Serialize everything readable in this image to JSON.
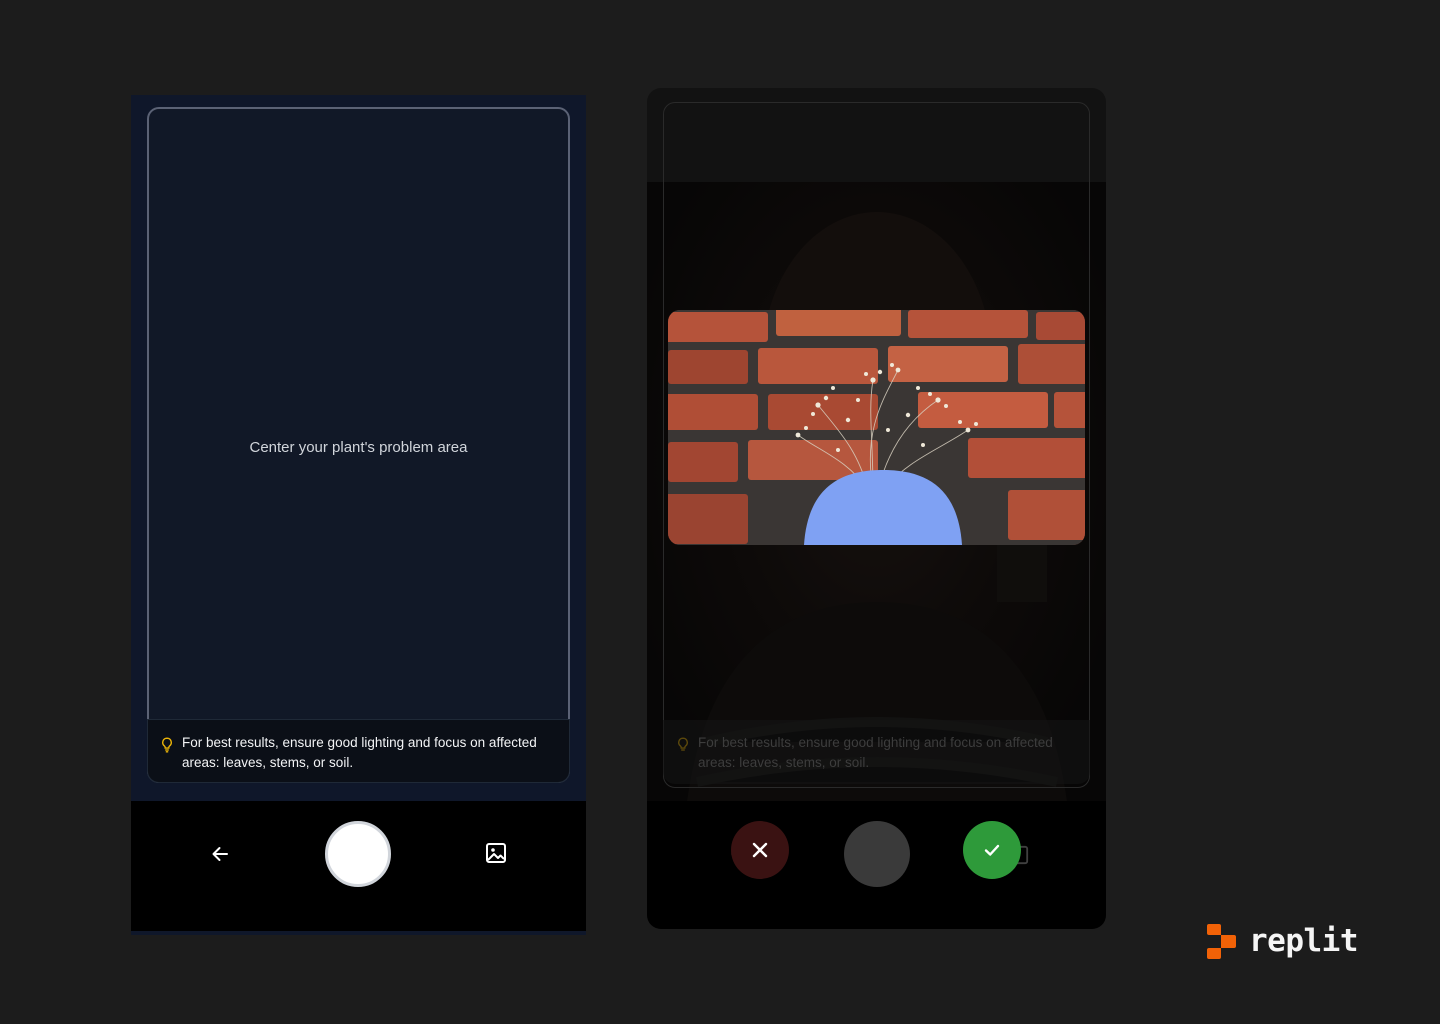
{
  "left_screen": {
    "center_hint": "Center your plant's problem area",
    "tip_text": "For best results, ensure good lighting and focus on affected areas: leaves, stems, or soil.",
    "tip_icon": "lightbulb-icon",
    "back_icon": "arrow-left-icon",
    "gallery_icon": "image-icon"
  },
  "right_screen": {
    "tip_text": "For best results, ensure good lighting and focus on affected areas: leaves, stems, or soil.",
    "cancel_icon": "close-icon",
    "confirm_icon": "check-icon"
  },
  "brand": {
    "name": "replit",
    "accent": "#f26207"
  },
  "colors": {
    "confirm": "#2e9a3a",
    "cancel": "#3a1212",
    "tip_icon": "#eab308"
  }
}
